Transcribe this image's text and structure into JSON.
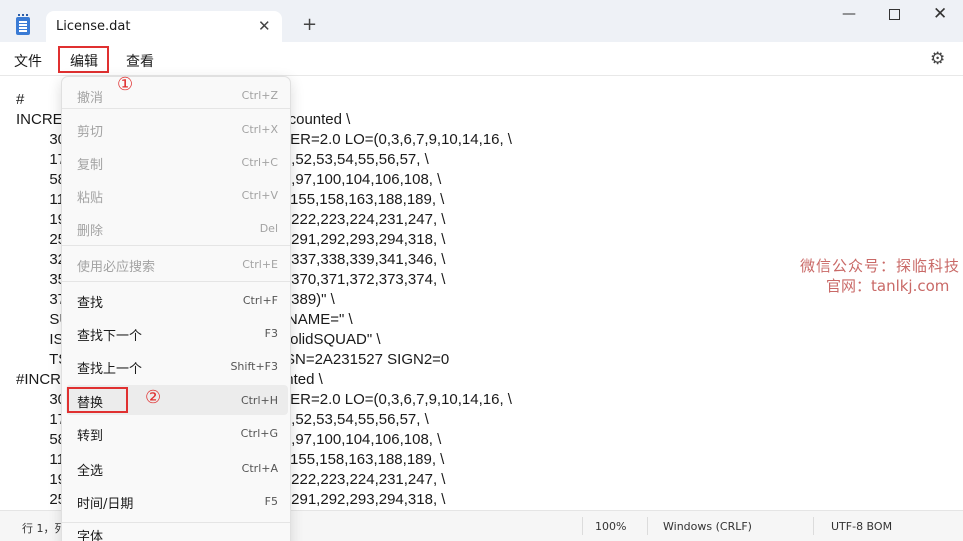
{
  "titlebar": {
    "tab_title": "License.dat",
    "tab_close": "✕",
    "new_tab": "+",
    "minimize": "—",
    "close": "✕"
  },
  "menubar": {
    "file": "文件",
    "edit": "编辑",
    "view": "查看",
    "settings_icon": "⚙"
  },
  "editor": {
    "lines": [
      {
        "text": "#"
      },
      {
        "text": "INCRE                          0 31-dec-2026 uncounted \\"
      },
      {
        "text": "        30                         R_STRING=\"VSVER=2.0 LO=(0,3,6,7,9,10,14,16, \\"
      },
      {
        "text": "        17                         34,40,45,47,48,51,52,53,54,55,56,57, \\"
      },
      {
        "text": "        58                         77,89,91,92,93,94,97,100,104,106,108, \\"
      },
      {
        "text": "        11                         ,134,135,137,148,155,158,163,188,189, \\"
      },
      {
        "text": "        19                         ,213,219,220,221,222,223,224,231,247, \\"
      },
      {
        "text": "        25                         ,277,278,282,283,291,292,293,294,318, \\"
      },
      {
        "text": "        32                         ,333,334,335,336,337,338,339,341,346, \\"
      },
      {
        "text": "        35                         ,366,367,368,369,370,371,372,373,374, \\"
      },
      {
        "text": "        37                         ,385,386,387,388,389)\" \\"
      },
      {
        "text": "        SU                         1.0 EXTERNAL_NAME=\" \\"
      },
      {
        "text": "        IS                         NOTICE=\"Team-SolidSQUAD\" \\"
      },
      {
        "text": "        TS                         -00-00-00-00-00 SN=2A231527 SIGN2=0"
      },
      {
        "text": "#INCR                          l-dec-2026 uncounted \\"
      },
      {
        "text": "        30                         R_STRING=\"VSVER=2.0 LO=(0,3,6,7,9,10,14,16, \\"
      },
      {
        "text": "        17                         34,40,45,47,48,51,52,53,54,55,56,57, \\"
      },
      {
        "text": "        58                         77,89,91,92,93,94,97,100,104,106,108, \\"
      },
      {
        "text": "        11                         ,134,135,137,148,155,158,163,188,189, \\"
      },
      {
        "text": "        19                         ,213,219,220,221,222,223,224,231,247, \\"
      },
      {
        "text": "        25                         ,277,278,282,283,291,292,293,294,318, \\"
      }
    ]
  },
  "watermark": {
    "line1": "微信公众号：探临科技",
    "line2": "官网：tanlkj.com"
  },
  "annotations": {
    "step1": "①",
    "step2": "②"
  },
  "dropdown": {
    "items": [
      {
        "label": "撤消",
        "shortcut": "Ctrl+Z",
        "enabled": false
      },
      {
        "label": "剪切",
        "shortcut": "Ctrl+X",
        "enabled": false
      },
      {
        "label": "复制",
        "shortcut": "Ctrl+C",
        "enabled": false
      },
      {
        "label": "粘贴",
        "shortcut": "Ctrl+V",
        "enabled": false
      },
      {
        "label": "删除",
        "shortcut": "Del",
        "enabled": false
      },
      {
        "label": "使用必应搜索",
        "shortcut": "Ctrl+E",
        "enabled": false
      },
      {
        "label": "查找",
        "shortcut": "Ctrl+F",
        "enabled": true
      },
      {
        "label": "查找下一个",
        "shortcut": "F3",
        "enabled": true
      },
      {
        "label": "查找上一个",
        "shortcut": "Shift+F3",
        "enabled": true
      },
      {
        "label": "替换",
        "shortcut": "Ctrl+H",
        "enabled": true,
        "highlighted": true
      },
      {
        "label": "转到",
        "shortcut": "Ctrl+G",
        "enabled": true
      },
      {
        "label": "全选",
        "shortcut": "Ctrl+A",
        "enabled": true
      },
      {
        "label": "时间/日期",
        "shortcut": "F5",
        "enabled": true
      },
      {
        "label": "字体",
        "shortcut": "",
        "enabled": true
      }
    ]
  },
  "statusbar": {
    "position": "行 1，列",
    "zoom": "100%",
    "line_ending": "Windows (CRLF)",
    "encoding": "UTF-8 BOM"
  }
}
